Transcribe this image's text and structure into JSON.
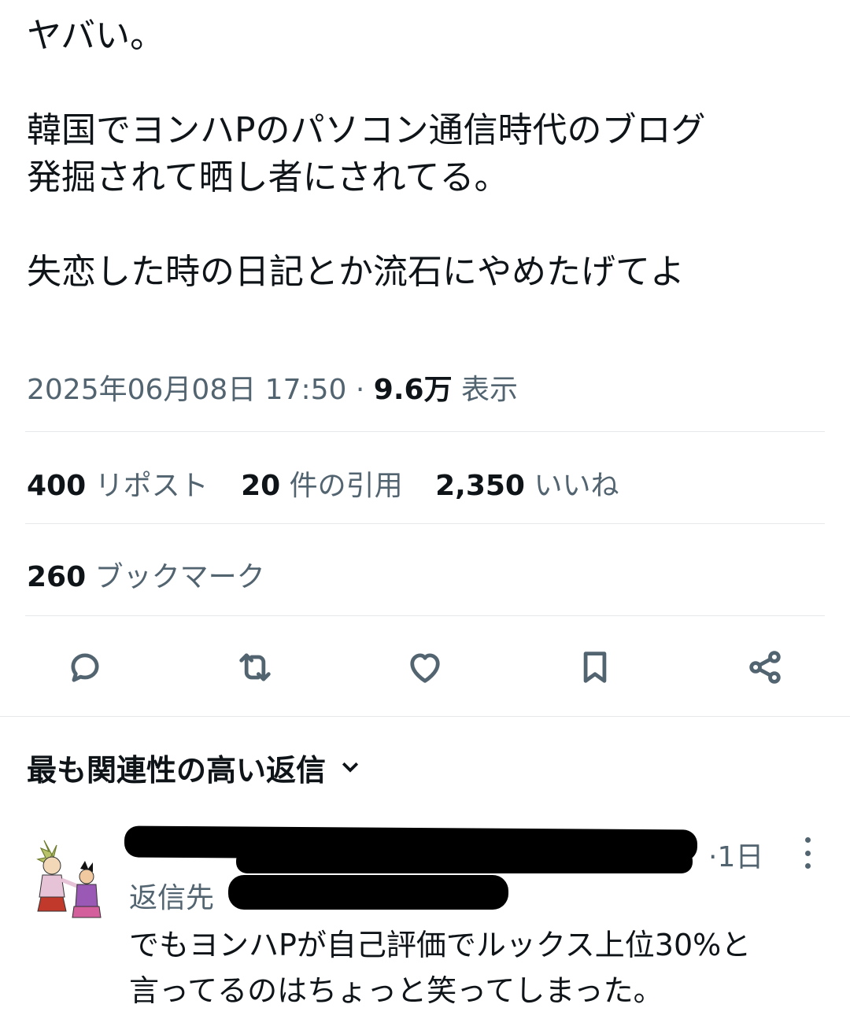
{
  "tweet": {
    "line1": "ヤバい。",
    "line2": "韓国でヨンハPのパソコン通信時代のブログ",
    "line3": "発掘されて晒し者にされてる。",
    "line4": "失恋した時の日記とか流石にやめたげてよ",
    "timestamp": "2025年06月08日 17:50",
    "separator": "·",
    "views_count": "9.6万",
    "views_label": "表示"
  },
  "stats": {
    "reposts_count": "400",
    "reposts_label": "リポスト",
    "quotes_count": "20",
    "quotes_label": "件の引用",
    "likes_count": "2,350",
    "likes_label": "いいね",
    "bookmarks_count": "260",
    "bookmarks_label": "ブックマーク"
  },
  "actions": {
    "icons": [
      "reply-icon",
      "repost-icon",
      "like-icon",
      "bookmark-icon",
      "share-icon"
    ]
  },
  "replies": {
    "sort_label": "最も関連性の高い返信"
  },
  "reply": {
    "time": "·1日",
    "reply_to_label": "返信先",
    "line1": "でもヨンハPが自己評価でルックス上位30%と",
    "line2": "言ってるのはちょっと笑ってしまった。"
  },
  "colors": {
    "text": "#0f1419",
    "secondary": "#536471",
    "divider": "#e6e9eb"
  }
}
